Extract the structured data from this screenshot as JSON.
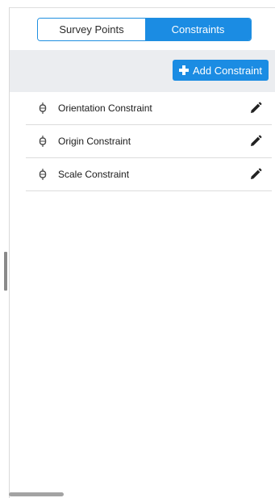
{
  "tabs": {
    "survey_points": "Survey Points",
    "constraints": "Constraints",
    "active": "constraints"
  },
  "toolbar": {
    "add_label": "Add Constraint",
    "add_icon": "plus-icon"
  },
  "constraints": [
    {
      "label": "Orientation Constraint",
      "icon": "constraint-icon",
      "action_icon": "pencil-icon"
    },
    {
      "label": "Origin Constraint",
      "icon": "constraint-icon",
      "action_icon": "pencil-icon"
    },
    {
      "label": "Scale Constraint",
      "icon": "constraint-icon",
      "action_icon": "pencil-icon"
    }
  ],
  "colors": {
    "accent": "#1b8ce3",
    "toolbar_bg": "#ebedf0",
    "divider": "#dcdcdc"
  }
}
